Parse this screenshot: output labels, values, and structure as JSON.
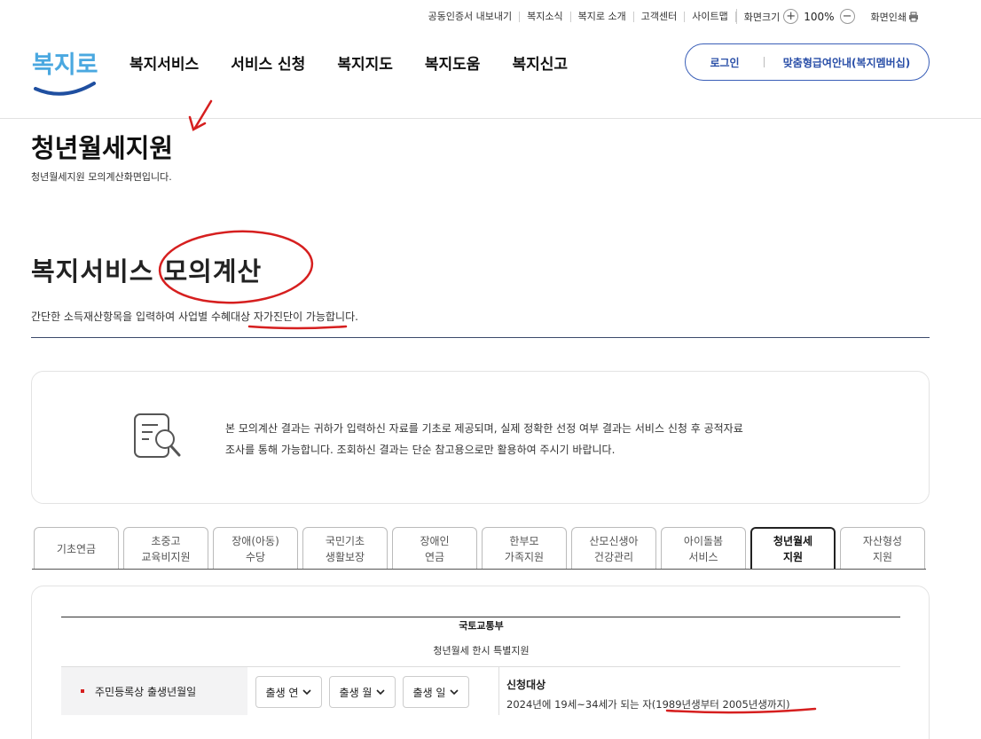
{
  "utility": {
    "items": [
      "공동인증서 내보내기",
      "복지소식",
      "복지로 소개",
      "고객센터",
      "사이트맵"
    ],
    "zoom_label": "화면크기",
    "zoom_in": "+",
    "zoom_value": "100%",
    "zoom_out": "−",
    "print_label": "화면인쇄"
  },
  "logo": {
    "text": "복지로",
    "color": "#4aa8e0"
  },
  "nav": {
    "items": [
      "복지서비스",
      "서비스 신청",
      "복지지도",
      "복지도움",
      "복지신고"
    ]
  },
  "auth": {
    "login": "로그인",
    "member": "맞춤형급여안내(복지멤버십)"
  },
  "page": {
    "title": "청년월세지원",
    "subtitle": "청년월세지원 모의계산화면입니다."
  },
  "section": {
    "title": "복지서비스 모의계산",
    "description": "간단한 소득재산항목을 입력하여 사업별 수혜대상 자가진단이 가능합니다."
  },
  "notice": {
    "line1": "본 모의계산 결과는 귀하가 입력하신 자료를 기초로 제공되며, 실제 정확한 선정 여부 결과는 서비스 신청 후 공적자료",
    "line2": "조사를 통해 가능합니다. 조회하신 결과는 단순 참고용으로만 활용하여 주시기 바랍니다."
  },
  "tabs": [
    {
      "l1": "기초연금",
      "l2": ""
    },
    {
      "l1": "초중고",
      "l2": "교육비지원"
    },
    {
      "l1": "장애(아동)",
      "l2": "수당"
    },
    {
      "l1": "국민기초",
      "l2": "생활보장"
    },
    {
      "l1": "장애인",
      "l2": "연금"
    },
    {
      "l1": "한부모",
      "l2": "가족지원"
    },
    {
      "l1": "산모신생아",
      "l2": "건강관리"
    },
    {
      "l1": "아이돌봄",
      "l2": "서비스"
    },
    {
      "l1": "청년월세",
      "l2": "지원"
    },
    {
      "l1": "자산형성",
      "l2": "지원"
    }
  ],
  "form": {
    "ministry": "국토교통부",
    "program": "청년월세 한시 특별지원",
    "birth_label": "주민등록상 출생년월일",
    "selects": [
      "출생 연",
      "출생 월",
      "출생 일"
    ],
    "eligibility_title": "신청대상",
    "eligibility_text": "2024년에 19세~34세가 되는 자(1989년생부터 2005년생까지)"
  },
  "colors": {
    "accent": "#2a4fa8",
    "annotation": "#d61f1f"
  }
}
